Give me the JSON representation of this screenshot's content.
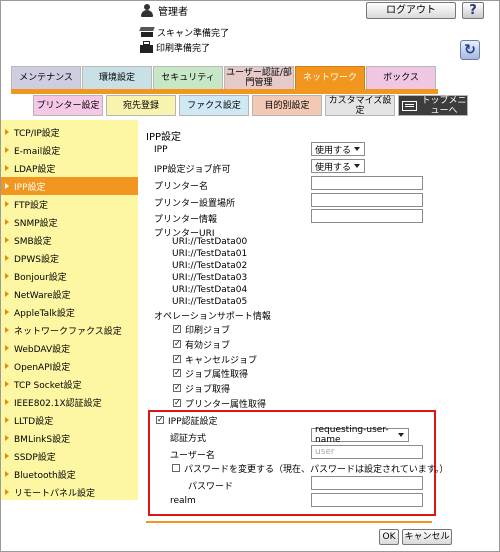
{
  "header": {
    "user_label": "管理者",
    "logout_label": "ログアウト",
    "help_label": "?",
    "status": [
      "スキャン準備完了",
      "印刷準備完了"
    ],
    "refresh_label": "↻"
  },
  "main_tabs": [
    "メンテナンス",
    "環境設定",
    "セキュリティ",
    "ユーザー認証/部門管理",
    "ネットワーク",
    "ボックス"
  ],
  "sub_tabs": [
    "プリンター設定",
    "宛先登録",
    "ファクス設定",
    "目的別設定",
    "カスタマイズ設定",
    "トップメニューへ"
  ],
  "sidebar": {
    "items": [
      "TCP/IP設定",
      "E-mail設定",
      "LDAP設定",
      "IPP設定",
      "FTP設定",
      "SNMP設定",
      "SMB設定",
      "DPWS設定",
      "Bonjour設定",
      "NetWare設定",
      "AppleTalk設定",
      "ネットワークファクス設定",
      "WebDAV設定",
      "OpenAPI設定",
      "TCP Socket設定",
      "IEEE802.1X認証設定",
      "LLTD設定",
      "BMLinkS設定",
      "SSDP設定",
      "Bluetooth設定",
      "リモートパネル設定"
    ],
    "selected": "IPP設定"
  },
  "form": {
    "title": "IPP設定",
    "ipp_label": "IPP",
    "ipp_value": "使用する",
    "job_permit_label": "IPP設定ジョブ許可",
    "job_permit_value": "使用する",
    "printer_name_label": "プリンター名",
    "printer_name_value": "",
    "printer_location_label": "プリンター設置場所",
    "printer_location_value": "",
    "printer_info_label": "プリンター情報",
    "printer_info_value": "",
    "printer_uri_label": "プリンターURI",
    "uris": [
      "URI://TestData00",
      "URI://TestData01",
      "URI://TestData02",
      "URI://TestData03",
      "URI://TestData04",
      "URI://TestData05"
    ],
    "ops_label": "オペレーションサポート情報",
    "ops": [
      {
        "label": "印刷ジョブ",
        "checked": "✓"
      },
      {
        "label": "有効ジョブ",
        "checked": "✓"
      },
      {
        "label": "キャンセルジョブ",
        "checked": "✓"
      },
      {
        "label": "ジョブ属性取得",
        "checked": "✓"
      },
      {
        "label": "ジョブ取得",
        "checked": "✓"
      },
      {
        "label": "プリンター属性取得",
        "checked": "✓"
      }
    ],
    "auth_label": "IPP認証設定",
    "auth_checked": "✓",
    "auth_method_label": "認証方式",
    "auth_method_value": "requesting-user-name",
    "username_label": "ユーザー名",
    "username_placeholder": "user",
    "change_pw_label": "パスワードを変更する（現在、パスワードは設定されています。）",
    "change_pw_checked": "",
    "password_label": "パスワード",
    "password_value": "",
    "realm_label": "realm",
    "realm_value": "",
    "ok_label": "OK",
    "cancel_label": "キャンセル"
  }
}
